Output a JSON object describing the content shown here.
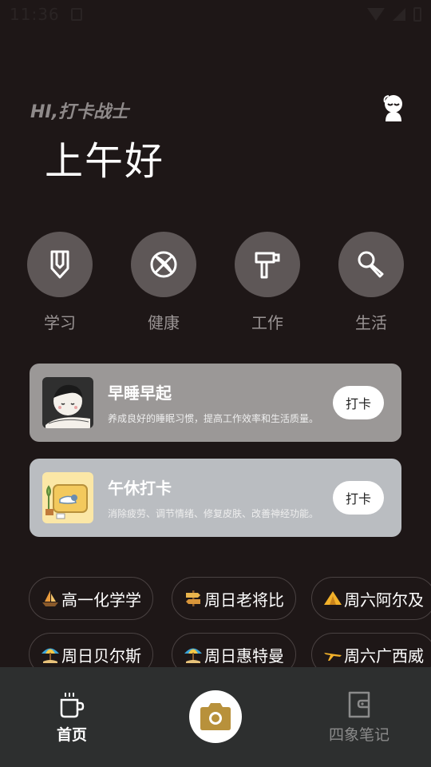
{
  "status_bar": {
    "time": "11:36"
  },
  "greeting": {
    "subtitle": "HI,打卡战士",
    "title": "上午好"
  },
  "categories": [
    {
      "label": "学习",
      "icon": "pencil-icon"
    },
    {
      "label": "健康",
      "icon": "basketball-icon"
    },
    {
      "label": "工作",
      "icon": "hammer-icon"
    },
    {
      "label": "生活",
      "icon": "microphone-icon"
    }
  ],
  "cards": [
    {
      "title": "早睡早起",
      "desc": "养成良好的睡眠习惯，提高工作效率和生活质量。",
      "button": "打卡",
      "bg": "#9b9897"
    },
    {
      "title": "午休打卡",
      "desc": "消除疲劳、调节情绪、修复皮肤、改善神经功能。",
      "button": "打卡",
      "bg": "#babdc1"
    }
  ],
  "tags": [
    {
      "label": "高一化学学",
      "icon": "boat-icon"
    },
    {
      "label": "周日老将比",
      "icon": "signpost-icon"
    },
    {
      "label": "周六阿尔及",
      "icon": "tent-icon"
    },
    {
      "label": "周日贝尔斯",
      "icon": "beach-umbrella-icon"
    },
    {
      "label": "周日惠特曼",
      "icon": "beach-umbrella-icon"
    },
    {
      "label": "周六广西威",
      "icon": "airplane-icon"
    }
  ],
  "bottom_nav": {
    "home": {
      "label": "首页",
      "icon": "coffee-cup-icon"
    },
    "camera": {
      "icon": "camera-icon"
    },
    "notes": {
      "label": "四象笔记",
      "icon": "wallet-icon"
    }
  },
  "colors": {
    "background": "#1e1717",
    "category_circle": "#5e5757",
    "nav_bar": "#2d2f2f",
    "camera_icon": "#b8913b"
  }
}
